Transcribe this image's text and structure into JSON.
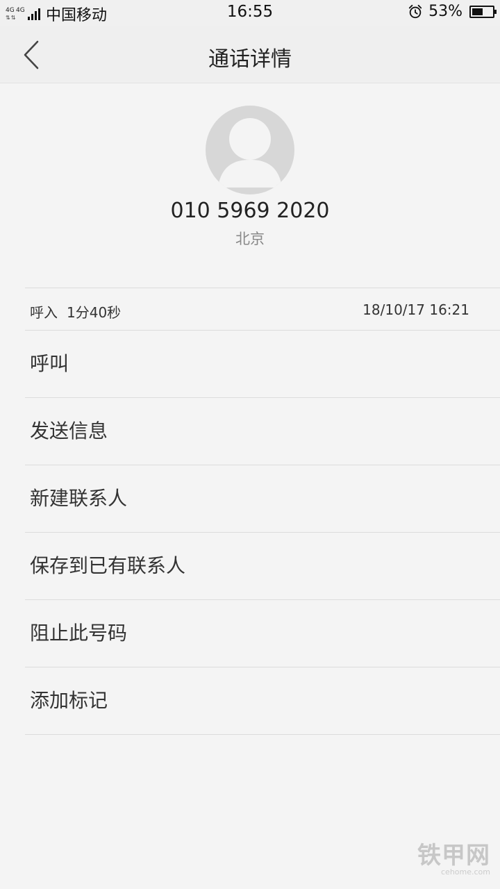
{
  "status_bar": {
    "network_label_1": "4G",
    "network_label_2": "4G",
    "carrier": "中国移动",
    "time": "16:55",
    "battery_percent": "53%",
    "battery_level": 0.53,
    "alarm_icon": "alarm-clock-icon"
  },
  "header": {
    "back_icon": "chevron-left-icon",
    "title": "通话详情"
  },
  "contact": {
    "avatar_icon": "default-avatar-icon",
    "phone_number": "010 5969 2020",
    "location": "北京"
  },
  "call_log": {
    "type": "呼入",
    "duration": "1分40秒",
    "datetime": "18/10/17 16:21"
  },
  "actions": [
    {
      "label": "呼叫"
    },
    {
      "label": "发送信息"
    },
    {
      "label": "新建联系人"
    },
    {
      "label": "保存到已有联系人"
    },
    {
      "label": "阻止此号码"
    },
    {
      "label": "添加标记"
    }
  ],
  "watermark": {
    "main": "铁甲网",
    "sub": "cehome.com"
  },
  "colors": {
    "background": "#f4f4f4",
    "header_bg": "#efefef",
    "avatar_bg": "#d7d7d7",
    "divider": "#dcdcdc"
  }
}
